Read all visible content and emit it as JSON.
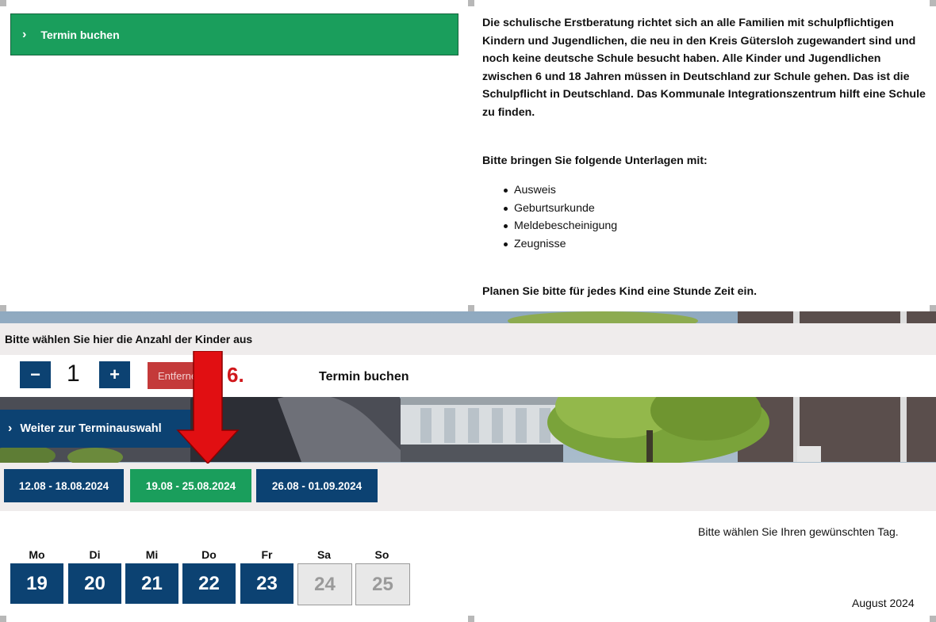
{
  "top": {
    "button_label": "Termin buchen",
    "intro_text": "Die schulische Erstberatung richtet sich an alle Familien mit schulpflichtigen Kindern und Jugendlichen, die neu in den Kreis Gütersloh zugewandert sind und noch keine deutsche Schule besucht haben. Alle Kinder und Jugendlichen zwischen 6 und 18 Jahren müssen in Deutschland zur Schule gehen. Das ist die Schulpflicht in Deutschland. Das Kommunale Integrationszentrum hilft eine Schule zu finden.",
    "docs_heading": "Bitte bringen Sie folgende Unterlagen mit:",
    "docs": [
      "Ausweis",
      "Geburtsurkunde",
      "Meldebescheinigung",
      "Zeugnisse"
    ],
    "time_note": "Planen Sie bitte für jedes Kind eine Stunde Zeit ein."
  },
  "kids": {
    "label": "Bitte wählen Sie hier die Anzahl der Kinder aus",
    "minus_label": "−",
    "count": "1",
    "plus_label": "+",
    "remove_label": "Entfernen",
    "booking_label": "Termin buchen"
  },
  "annotation": {
    "step_number": "6."
  },
  "continue_label": "Weiter zur Terminauswahl",
  "weeks": [
    {
      "label": "12.08 - 18.08.2024",
      "active": false
    },
    {
      "label": "19.08 - 25.08.2024",
      "active": true
    },
    {
      "label": "26.08 - 01.09.2024",
      "active": false
    }
  ],
  "choose_day_text": "Bitte wählen Sie Ihren gewünschten Tag.",
  "weekdays": [
    "Mo",
    "Di",
    "Mi",
    "Do",
    "Fr",
    "Sa",
    "So"
  ],
  "days": [
    {
      "num": "19",
      "available": true
    },
    {
      "num": "20",
      "available": true
    },
    {
      "num": "21",
      "available": true
    },
    {
      "num": "22",
      "available": true
    },
    {
      "num": "23",
      "available": true
    },
    {
      "num": "24",
      "available": false
    },
    {
      "num": "25",
      "available": false
    }
  ],
  "month_label": "August 2024",
  "colors": {
    "green": "#1a9e5c",
    "navy": "#0c4272",
    "red": "#c43a3a",
    "arrow": "#e10f12"
  }
}
